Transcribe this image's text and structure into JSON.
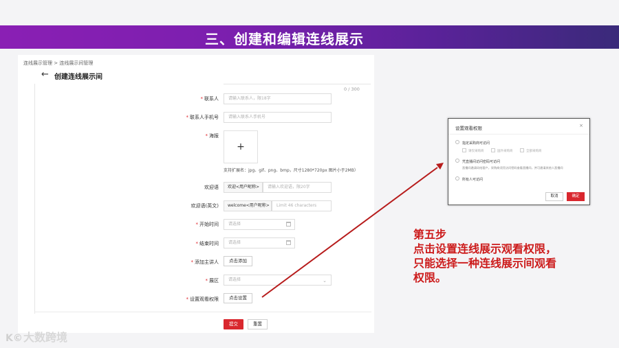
{
  "slide": {
    "title": "三、创建和编辑连线展示"
  },
  "screen": {
    "breadcrumb": "连线展示管理 > 连线展示间管理",
    "page_title": "创建连线展示间",
    "counter": "0 / 300",
    "fields": {
      "contact": {
        "label": "联系人",
        "placeholder": "请输入联系人，限18字"
      },
      "phone": {
        "label": "联系人手机号",
        "placeholder": "请输入联系人手机号"
      },
      "poster": {
        "label": "海报",
        "upload_symbol": "+",
        "hint": "支持扩展名：jpg、gif、png、bmp，尺寸1280*720px 图片小于2MB）"
      },
      "welcome": {
        "label": "欢迎语",
        "prefix": "欢迎<用户昵称>",
        "placeholder": "请输入欢迎语，限20字"
      },
      "welcome_en": {
        "label": "欢迎语(英文)",
        "prefix": "welcome<用户昵称>",
        "placeholder": "Limit 46 characters"
      },
      "start_time": {
        "label": "开始时间",
        "placeholder": "请选择"
      },
      "end_time": {
        "label": "结束时间",
        "placeholder": "请选择"
      },
      "speaker": {
        "label": "添加主讲人",
        "button": "点击添加"
      },
      "zone": {
        "label": "展区",
        "placeholder": "请选择"
      },
      "permission": {
        "label": "设置观看权限",
        "button": "点击设置"
      }
    },
    "required_mark": "*",
    "submit": "提交",
    "reset": "重置"
  },
  "dialog": {
    "title": "设置观看权限",
    "close": "×",
    "option1": "指定采购商可访问",
    "option1_subs": [
      "请仅采购商",
      "国外采购商",
      "全部采购商"
    ],
    "option2": "凭直播间访问密码可访问",
    "option2_desc": "直播间邀请码给客户，采购商须凭访问密码查看直播间，并可邀请其他人直播间",
    "option3": "所有人可访问",
    "cancel": "取消",
    "ok": "确定"
  },
  "step": {
    "line1": "第五步",
    "line2": "点击设置连线展示观看权限，",
    "line3": "只能选择一种连线展示间观看",
    "line4": "权限。"
  },
  "watermark": {
    "logo": "K©",
    "text": "大数跨境"
  },
  "colors": {
    "banner_start": "#8a1fb4",
    "banner_end": "#3a2a7a",
    "accent_red": "#d9272e",
    "step_text": "#cc1b1b"
  }
}
